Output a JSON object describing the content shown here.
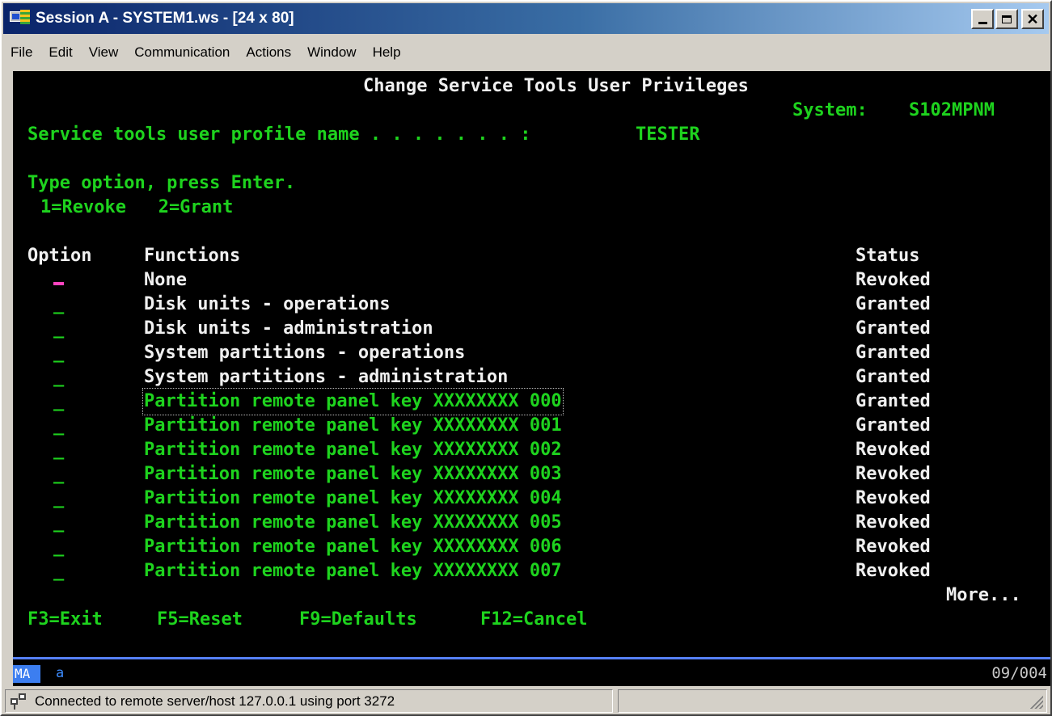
{
  "window": {
    "title": "Session A - SYSTEM1.ws - [24 x 80]",
    "app_icon": "terminal-session-icon",
    "controls": [
      "minimize-icon",
      "maximize-icon",
      "close-icon"
    ]
  },
  "menu": [
    "File",
    "Edit",
    "View",
    "Communication",
    "Actions",
    "Window",
    "Help"
  ],
  "screen": {
    "title": "Change Service Tools User Privileges",
    "system_label": "System:",
    "system_value": "S102MPNM",
    "profile_label": "Service tools user profile name . . . . . . . :",
    "profile_value": "TESTER",
    "instruction": "Type option, press Enter.",
    "options_legend": "1=Revoke   2=Grant",
    "col_option": "Option",
    "col_functions": "Functions",
    "col_status": "Status",
    "option_placeholder": "_",
    "rows": [
      {
        "function": "None",
        "status": "Revoked"
      },
      {
        "function": "Disk units - operations",
        "status": "Granted"
      },
      {
        "function": "Disk units - administration",
        "status": "Granted"
      },
      {
        "function": "System partitions - operations",
        "status": "Granted"
      },
      {
        "function": "System partitions - administration",
        "status": "Granted"
      },
      {
        "function": "Partition remote panel key XXXXXXXX 000",
        "status": "Granted"
      },
      {
        "function": "Partition remote panel key XXXXXXXX 001",
        "status": "Granted"
      },
      {
        "function": "Partition remote panel key XXXXXXXX 002",
        "status": "Revoked"
      },
      {
        "function": "Partition remote panel key XXXXXXXX 003",
        "status": "Revoked"
      },
      {
        "function": "Partition remote panel key XXXXXXXX 004",
        "status": "Revoked"
      },
      {
        "function": "Partition remote panel key XXXXXXXX 005",
        "status": "Revoked"
      },
      {
        "function": "Partition remote panel key XXXXXXXX 006",
        "status": "Revoked"
      },
      {
        "function": "Partition remote panel key XXXXXXXX 007",
        "status": "Revoked"
      }
    ],
    "more": "More...",
    "function_keys": [
      "F3=Exit",
      "F5=Reset",
      "F9=Defaults",
      "F12=Cancel"
    ]
  },
  "oia": {
    "mode": "MA",
    "input": "a",
    "cursor_position": "09/004"
  },
  "statusbar": {
    "icon": "connection-icon",
    "text": "Connected to remote server/host 127.0.0.1 using port 3272"
  },
  "colors": {
    "terminal_green": "#1ed31e",
    "terminal_white": "#f0f0f0",
    "terminal_bg": "#000000",
    "cursor_pink": "#ff44c0",
    "titlebar_blue": "#0a246a"
  }
}
